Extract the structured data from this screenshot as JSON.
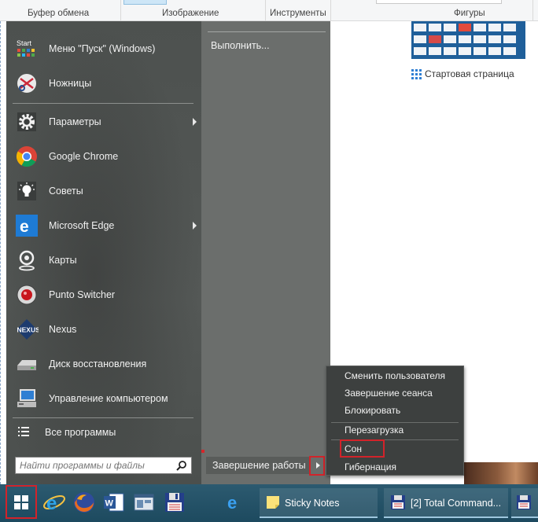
{
  "ribbon": {
    "groups": [
      "Буфер обмена",
      "Изображение",
      "Инструменты",
      "Фигуры"
    ]
  },
  "background": {
    "start_page_label": "Стартовая страница"
  },
  "start_menu": {
    "apps": [
      {
        "label": "Меню \"Пуск\" (Windows)",
        "icon": "start-menu-icon",
        "arrow": false
      },
      {
        "label": "Ножницы",
        "icon": "scissors-icon",
        "arrow": false
      },
      {
        "label": "Параметры",
        "icon": "gear-icon",
        "arrow": true
      },
      {
        "label": "Google Chrome",
        "icon": "chrome-icon",
        "arrow": false
      },
      {
        "label": "Советы",
        "icon": "lightbulb-icon",
        "arrow": false
      },
      {
        "label": "Microsoft Edge",
        "icon": "edge-icon",
        "arrow": true
      },
      {
        "label": "Карты",
        "icon": "maps-icon",
        "arrow": false
      },
      {
        "label": "Punto Switcher",
        "icon": "punto-switcher-icon",
        "arrow": false
      },
      {
        "label": "Nexus",
        "icon": "nexus-icon",
        "arrow": false
      },
      {
        "label": "Диск восстановления",
        "icon": "recovery-drive-icon",
        "arrow": false
      },
      {
        "label": "Управление компьютером",
        "icon": "computer-management-icon",
        "arrow": false
      }
    ],
    "start_icon_text": "Start",
    "nexus_icon_text": "NEXUS",
    "all_programs": "Все программы",
    "search_placeholder": "Найти программы и файлы",
    "run": "Выполнить...",
    "shutdown": "Завершение работы"
  },
  "power_menu": {
    "items": [
      "Сменить пользователя",
      "Завершение сеанса",
      "Блокировать",
      "Перезагрузка",
      "Сон",
      "Гибернация"
    ]
  },
  "taskbar": {
    "sticky_notes": "Sticky Notes",
    "total_commander": "[2] Total Command..."
  },
  "colors": {
    "highlight": "#d2232a",
    "menu_bg": "#565a58",
    "taskbar": "#1f4e63"
  }
}
